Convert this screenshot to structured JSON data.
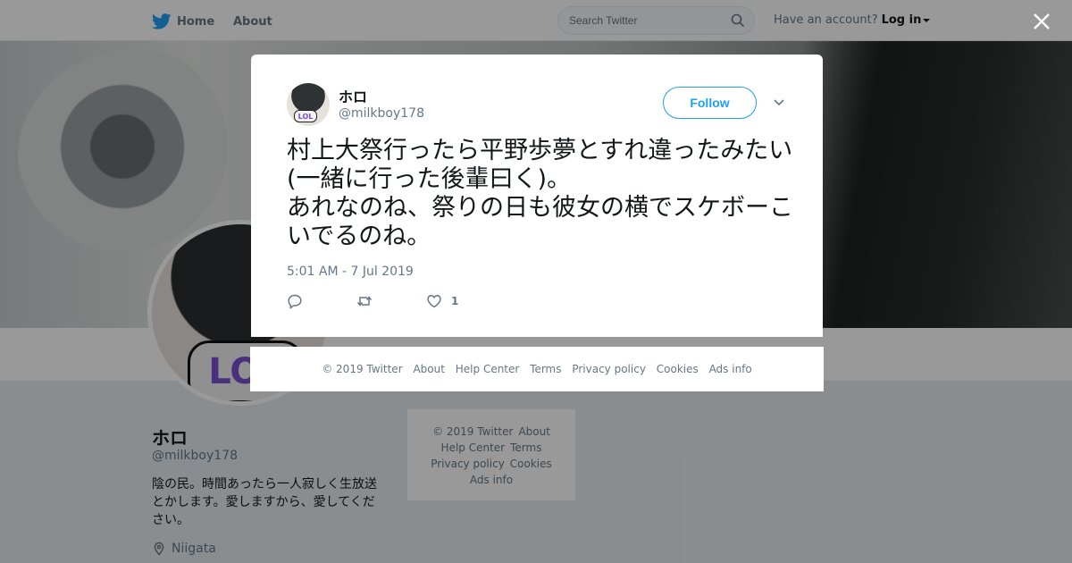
{
  "nav": {
    "home": "Home",
    "about": "About",
    "search_placeholder": "Search Twitter",
    "have_account": "Have an account?",
    "login": "Log in"
  },
  "profile": {
    "name": "ホロ",
    "handle": "@milkboy178",
    "bio": "陰の民。時間あったら一人寂しく生放送とかします。愛しますから、愛してください。",
    "location": "Niigata",
    "avatar_badge": "LOL"
  },
  "side_footer": {
    "links": [
      "© 2019 Twitter",
      "About",
      "Help Center",
      "Terms",
      "Privacy policy",
      "Cookies",
      "Ads info"
    ]
  },
  "tweet": {
    "name": "ホロ",
    "handle": "@milkboy178",
    "avatar_badge": "LOL",
    "follow": "Follow",
    "text": "村上大祭行ったら平野歩夢とすれ違ったみたい(一緒に行った後輩曰く)。\nあれなのね、祭りの日も彼女の横でスケボーこいでるのね。",
    "timestamp": "5:01 AM - 7 Jul 2019",
    "likes": "1"
  },
  "modal_footer": {
    "links": [
      "© 2019 Twitter",
      "About",
      "Help Center",
      "Terms",
      "Privacy policy",
      "Cookies",
      "Ads info"
    ]
  },
  "icons": {
    "logo": "twitter-bird-icon",
    "search": "search-icon",
    "close": "close-icon",
    "more": "chevron-down-icon",
    "reply": "reply-icon",
    "retweet": "retweet-icon",
    "like": "heart-icon",
    "location": "location-pin-icon"
  },
  "colors": {
    "accent": "#1da1f2",
    "secondary_text": "#657786"
  }
}
